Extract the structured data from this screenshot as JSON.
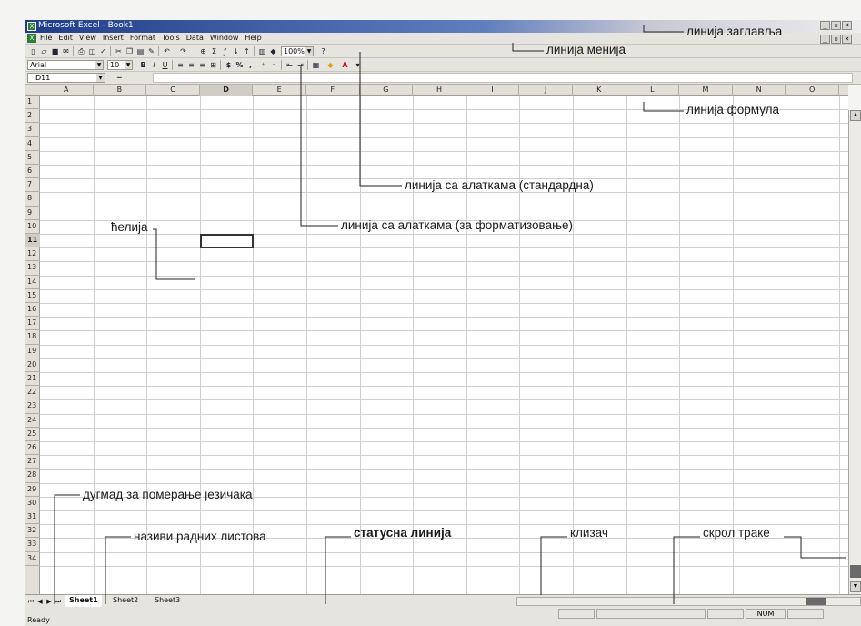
{
  "window": {
    "title": "Microsoft Excel - Book1",
    "controls": [
      "_",
      "▫",
      "×"
    ]
  },
  "menu": {
    "items": [
      "File",
      "Edit",
      "View",
      "Insert",
      "Format",
      "Tools",
      "Data",
      "Window",
      "Help"
    ],
    "doc_controls": [
      "_",
      "▫",
      "×"
    ]
  },
  "toolbar_standard": {
    "zoom": "100%",
    "help_icon": "?"
  },
  "toolbar_format": {
    "font": "Arial",
    "size": "10",
    "bold": "B",
    "italic": "I",
    "underline": "U",
    "currency": "$",
    "percent": "%",
    "comma": ","
  },
  "formula_bar": {
    "name_box": "D11",
    "equals": "="
  },
  "grid": {
    "columns": [
      "A",
      "B",
      "C",
      "D",
      "E",
      "F",
      "G",
      "H",
      "I",
      "J",
      "K",
      "L",
      "M",
      "N",
      "O"
    ],
    "rows": [
      "1",
      "2",
      "3",
      "4",
      "5",
      "6",
      "7",
      "8",
      "9",
      "10",
      "11",
      "12",
      "13",
      "14",
      "15",
      "16",
      "17",
      "18",
      "19",
      "20",
      "21",
      "22",
      "23",
      "24",
      "25",
      "26",
      "27",
      "28",
      "29",
      "30",
      "31",
      "32",
      "33",
      "34"
    ],
    "active_column": "D",
    "active_row": "11"
  },
  "sheets": {
    "tabs": [
      "Sheet1",
      "Sheet2",
      "Sheet3"
    ],
    "active": "Sheet1"
  },
  "status": {
    "text": "Ready",
    "num_indicator": "NUM"
  },
  "annotations": {
    "title_bar": "линија заглавља",
    "menu_bar": "линија менија",
    "formula_bar": "линија формула",
    "toolbar_standard": "линија са алаткама (стандардна)",
    "toolbar_format": "линија са алаткама (за форматизовање)",
    "cell": "ћелија",
    "tab_scroll_buttons": "дугмад за померање језичака",
    "sheet_names": "називи радних листова",
    "status_bar": "статусна линија",
    "slider": "клизач",
    "scroll_bars": "скрол траке"
  }
}
